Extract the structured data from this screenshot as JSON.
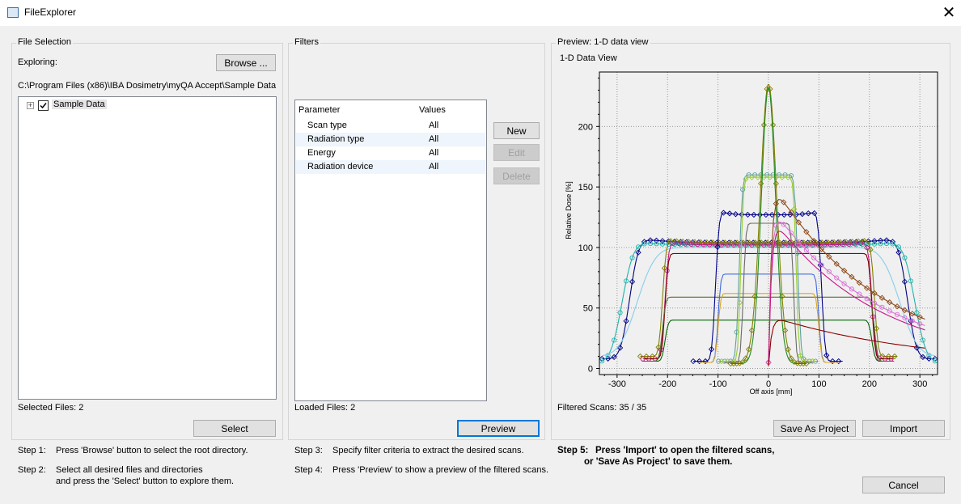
{
  "window": {
    "title": "FileExplorer"
  },
  "file_selection": {
    "group_label": "File Selection",
    "exploring_label": "Exploring:",
    "browse_button": "Browse ...",
    "path": "C:\\Program Files (x86)\\IBA Dosimetry\\myQA Accept\\Sample Data",
    "tree_items": [
      {
        "label": "Sample Data",
        "checked": true,
        "expanded": false
      }
    ],
    "selected_files": "Selected Files: 2",
    "select_button": "Select"
  },
  "filters": {
    "group_label": "Filters",
    "columns": [
      "Parameter",
      "Values"
    ],
    "rows": [
      {
        "parameter": "Scan type",
        "value": "All"
      },
      {
        "parameter": "Radiation type",
        "value": "All"
      },
      {
        "parameter": "Energy",
        "value": "All"
      },
      {
        "parameter": "Radiation device",
        "value": "All"
      }
    ],
    "new_button": "New",
    "edit_button": "Edit",
    "delete_button": "Delete",
    "loaded_files": "Loaded Files: 2",
    "preview_button": "Preview"
  },
  "preview": {
    "group_label": "Preview: 1-D data view",
    "chart_title": "1-D Data View",
    "filtered_scans": "Filtered Scans: 35 / 35",
    "save_as_project_button": "Save As Project",
    "import_button": "Import"
  },
  "steps": {
    "step1_num": "Step 1:",
    "step1_text": "Press 'Browse' button to select the root directory.",
    "step2_num": "Step 2:",
    "step2_line1": "Select all desired files and directories",
    "step2_line2": "and press the 'Select' button to explore them.",
    "step3_num": "Step 3:",
    "step3_text": "Specify filter criteria to extract the desired scans.",
    "step4_num": "Step 4:",
    "step4_text": "Press 'Preview' to show a preview of the filtered scans.",
    "step5_num": "Step 5:",
    "step5_line1": "Press 'Import' to open the filtered scans,",
    "step5_line2": "or 'Save As Project' to save them."
  },
  "cancel_button": "Cancel",
  "chart_data": {
    "type": "line",
    "title": "",
    "xlabel": "Off axis [mm]",
    "ylabel": "Relative Dose [%]",
    "xlim": [
      -335,
      335
    ],
    "ylim": [
      -5,
      245
    ],
    "xticks": [
      -300,
      -200,
      -100,
      0,
      100,
      200,
      300
    ],
    "yticks": [
      0,
      50,
      100,
      150,
      200
    ],
    "grid": true,
    "series": [
      {
        "color": "#000080",
        "marker": "diamond",
        "w": 275,
        "p": 104,
        "pen": 20,
        "tail": 8,
        "horns": 4
      },
      {
        "color": "#20b2aa",
        "marker": "circle",
        "w": 290,
        "p": 102,
        "pen": 25,
        "tail": 5,
        "horns": 3
      },
      {
        "color": "#87ceeb",
        "marker": "none",
        "w": 260,
        "p": 100,
        "pen": 40,
        "tail": 10,
        "horns": 0
      },
      {
        "color": "#808000",
        "marker": "diamond",
        "w": 210,
        "p": 104,
        "pen": 8,
        "tail": 10,
        "horns": 2
      },
      {
        "color": "#c71585",
        "marker": "circle",
        "w": 205,
        "p": 102,
        "pen": 8,
        "tail": 8,
        "horns": 2
      },
      {
        "color": "#800000",
        "marker": "none",
        "w": 205,
        "p": 95,
        "pen": 7,
        "tail": 8,
        "horns": 0
      },
      {
        "color": "#006400",
        "marker": "none",
        "w": 205,
        "p": 40,
        "pen": 7,
        "tail": 6,
        "horns": 0
      },
      {
        "color": "#556b2f",
        "marker": "none",
        "w": 210,
        "p": 59,
        "pen": 7,
        "tail": 6,
        "horns": 0
      },
      {
        "color": "#00008b",
        "marker": "diamond",
        "w": 105,
        "p": 127,
        "pen": 8,
        "tail": 6,
        "horns": 3
      },
      {
        "color": "#4169e1",
        "marker": "none",
        "w": 100,
        "p": 78,
        "pen": 6,
        "tail": 5,
        "horns": 0
      },
      {
        "color": "#daa520",
        "marker": "none",
        "w": 100,
        "p": 62,
        "pen": 6,
        "tail": 5,
        "horns": 0
      },
      {
        "color": "#5f9ea0",
        "marker": "circle",
        "w": 58,
        "p": 160,
        "pen": 7,
        "tail": 6,
        "horns": 0
      },
      {
        "color": "#9acd32",
        "marker": "diamond",
        "w": 55,
        "p": 158,
        "pen": 6,
        "tail": 6,
        "horns": 0
      },
      {
        "color": "#696969",
        "marker": "none",
        "w": 50,
        "p": 120,
        "pen": 6,
        "tail": 5,
        "horns": 0
      }
    ],
    "central": [
      {
        "color": "#808000",
        "marker": "diamond",
        "peak": 235,
        "sigma": 16
      },
      {
        "color": "#228b22",
        "marker": "none",
        "peak": 232,
        "sigma": 14
      }
    ],
    "depth_curves": [
      {
        "color": "#8b4513",
        "marker": "diamond",
        "start": 5,
        "peak": 150,
        "end": 35
      },
      {
        "color": "#da70d6",
        "marker": "circle",
        "start": 5,
        "peak": 130,
        "end": 30
      },
      {
        "color": "#c71585",
        "marker": "none",
        "start": 3,
        "peak": 122,
        "end": 28
      },
      {
        "color": "#8b0000",
        "marker": "none",
        "start": 2,
        "peak": 42,
        "end": 15
      }
    ]
  }
}
